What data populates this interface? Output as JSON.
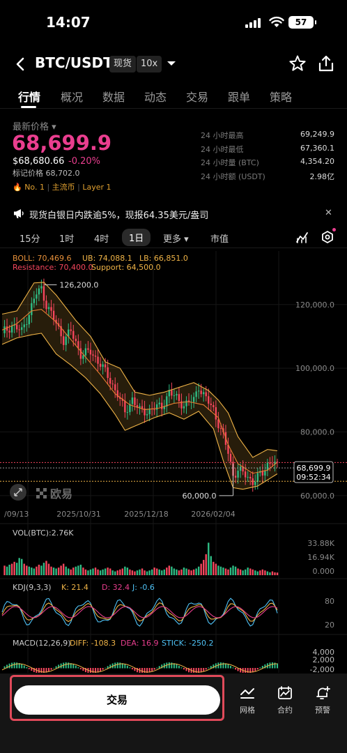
{
  "status": {
    "time": "14:07",
    "battery": "57"
  },
  "header": {
    "pair": "BTC/USDT",
    "spot_tag": "现货",
    "leverage_tag": "10x"
  },
  "tabs": [
    "行情",
    "概况",
    "数据",
    "动态",
    "交易",
    "跟单",
    "策略"
  ],
  "price": {
    "label": "最新价格",
    "last": "68,699.9",
    "usd": "$68,680.66",
    "change": "-0.20%",
    "mark": "标记价格 68,702.0",
    "rank": "No. 1",
    "tag1": "主流币",
    "tag2": "Layer 1"
  },
  "stats": [
    {
      "label": "24 小时最高",
      "value": "69,249.9"
    },
    {
      "label": "24 小时最低",
      "value": "67,360.1"
    },
    {
      "label": "24 小时量 (BTC)",
      "value": "4,354.20"
    },
    {
      "label": "24 小时额 (USDT)",
      "value": "2.98亿"
    }
  ],
  "notice": {
    "text": "现货白银日内跌逾5%，现报64.35美元/盎司"
  },
  "intervals": {
    "m15": "15分",
    "h1": "1时",
    "h4": "4时",
    "d1": "1日",
    "more": "更多",
    "mcap": "市值"
  },
  "colors": {
    "up": "#2ebd85",
    "down": "#f6465d",
    "accent": "#ea3e8f",
    "boll_mid": "#e87e31",
    "boll_band": "#f0b447"
  },
  "chart_data": [
    {
      "type": "candlestick",
      "title": "BTC/USDT 1日",
      "indicator": {
        "boll": "BOLL: 70,469.6",
        "ub": "UB: 74,088.1",
        "lb": "LB: 66,851.0"
      },
      "levels": {
        "resistance": "Resistance: 70,400.0",
        "support": "Support: 64,500.0"
      },
      "y_ticks": [
        "120,000.0",
        "100,000.0",
        "80,000.0",
        "60,000.0"
      ],
      "ylim": [
        58000,
        132000
      ],
      "x_ticks": [
        "/09/13",
        "2025/10/31",
        "2025/12/18",
        "2026/02/04"
      ],
      "annotations": {
        "high": "126,200.0",
        "low": "60,000.0"
      },
      "price_tag": {
        "price": "68,699.9",
        "countdown": "09:52:34"
      },
      "watermark": "欧易",
      "close_path": [
        [
          0,
          111000
        ],
        [
          4,
          113500
        ],
        [
          8,
          111500
        ],
        [
          11,
          117500
        ],
        [
          14,
          123500
        ],
        [
          16,
          125000
        ],
        [
          18,
          120000
        ],
        [
          22,
          114000
        ],
        [
          25,
          109000
        ],
        [
          28,
          111500
        ],
        [
          32,
          104500
        ],
        [
          36,
          105000
        ],
        [
          40,
          101500
        ],
        [
          44,
          96000
        ],
        [
          47,
          92000
        ],
        [
          50,
          86000
        ],
        [
          53,
          90500
        ],
        [
          56,
          86500
        ],
        [
          59,
          86500
        ],
        [
          62,
          87500
        ],
        [
          65,
          88000
        ],
        [
          68,
          92500
        ],
        [
          71,
          90500
        ],
        [
          74,
          88500
        ],
        [
          78,
          90000
        ],
        [
          80,
          94500
        ],
        [
          82,
          91500
        ],
        [
          86,
          87000
        ],
        [
          90,
          78500
        ],
        [
          92,
          73500
        ],
        [
          94,
          66500
        ],
        [
          96,
          68000
        ],
        [
          99,
          66500
        ],
        [
          102,
          64500
        ],
        [
          106,
          67000
        ],
        [
          108,
          70000
        ],
        [
          110,
          71000
        ],
        [
          112,
          68700
        ]
      ],
      "boll_mid_path": [
        [
          0,
          112000
        ],
        [
          6,
          114000
        ],
        [
          12,
          118000
        ],
        [
          16,
          118500
        ],
        [
          22,
          114500
        ],
        [
          28,
          109000
        ],
        [
          34,
          103500
        ],
        [
          40,
          98000
        ],
        [
          46,
          92000
        ],
        [
          52,
          88500
        ],
        [
          58,
          87000
        ],
        [
          64,
          87500
        ],
        [
          70,
          89000
        ],
        [
          76,
          89500
        ],
        [
          82,
          88500
        ],
        [
          88,
          84500
        ],
        [
          92,
          76000
        ],
        [
          96,
          70000
        ],
        [
          102,
          67000
        ],
        [
          108,
          68000
        ],
        [
          112,
          70469
        ]
      ],
      "boll_upper_path": [
        [
          0,
          117000
        ],
        [
          6,
          118000
        ],
        [
          13,
          126800
        ],
        [
          17,
          127000
        ],
        [
          22,
          123000
        ],
        [
          30,
          115000
        ],
        [
          36,
          110000
        ],
        [
          42,
          102000
        ],
        [
          48,
          100000
        ],
        [
          54,
          92500
        ],
        [
          60,
          91500
        ],
        [
          66,
          92500
        ],
        [
          72,
          94000
        ],
        [
          78,
          95500
        ],
        [
          84,
          93000
        ],
        [
          88,
          90000
        ],
        [
          92,
          86000
        ],
        [
          96,
          78500
        ],
        [
          102,
          72000
        ],
        [
          108,
          74500
        ],
        [
          112,
          74088
        ]
      ],
      "boll_lower_path": [
        [
          0,
          107500
        ],
        [
          6,
          109500
        ],
        [
          12,
          110500
        ],
        [
          16,
          111000
        ],
        [
          22,
          104500
        ],
        [
          28,
          101000
        ],
        [
          34,
          97000
        ],
        [
          40,
          92000
        ],
        [
          46,
          85500
        ],
        [
          50,
          80500
        ],
        [
          56,
          82500
        ],
        [
          62,
          84500
        ],
        [
          68,
          86000
        ],
        [
          74,
          84000
        ],
        [
          80,
          86500
        ],
        [
          86,
          81000
        ],
        [
          90,
          71000
        ],
        [
          94,
          62500
        ],
        [
          98,
          62000
        ],
        [
          104,
          63000
        ],
        [
          112,
          66851
        ]
      ]
    },
    {
      "type": "bar",
      "title": "VOL(BTC):2.76K",
      "y_ticks": [
        "33.88K",
        "16.94K",
        "0.000"
      ],
      "ylim": [
        0,
        35000
      ],
      "values_k": [
        10,
        9,
        11,
        12,
        14,
        13,
        18,
        17,
        12,
        10,
        9,
        8,
        7,
        9,
        11,
        10,
        13,
        15,
        12,
        9,
        8,
        7,
        8,
        10,
        12,
        9,
        7,
        6,
        8,
        9,
        10,
        11,
        8,
        6,
        5,
        6,
        7,
        8,
        6,
        5,
        6,
        7,
        8,
        7,
        5,
        4,
        5,
        6,
        7,
        9,
        8,
        6,
        5,
        4,
        5,
        6,
        7,
        5,
        4,
        5,
        6,
        8,
        7,
        6,
        5,
        6,
        8,
        10,
        9,
        7,
        6,
        5,
        6,
        8,
        7,
        6,
        5,
        6,
        7,
        9,
        12,
        16,
        22,
        34,
        20,
        14,
        12,
        10,
        9,
        8,
        7,
        6,
        8,
        10,
        9,
        7,
        6,
        5,
        6,
        8,
        7,
        6,
        5,
        4,
        5,
        6,
        5,
        4,
        3,
        4,
        3,
        2.76
      ]
    },
    {
      "type": "line",
      "title": "KDJ(9,3,3)",
      "series_labels": {
        "k": "K: 21.4",
        "d": "D: 32.4",
        "j": "J: -0.6"
      },
      "y_ticks": [
        "80",
        "20"
      ],
      "ylim": [
        -10,
        110
      ]
    },
    {
      "type": "bar",
      "title": "MACD(12,26,9)",
      "series_labels": {
        "diff": "DIFF: -108.3",
        "dea": "DEA: 16.9",
        "stick": "STICK: -250.2"
      },
      "y_ticks": [
        "4,000",
        "2,000",
        "-2,000"
      ]
    }
  ],
  "bottom": {
    "trade": "交易",
    "grid": "网格",
    "futures": "合约",
    "alert": "预警"
  }
}
